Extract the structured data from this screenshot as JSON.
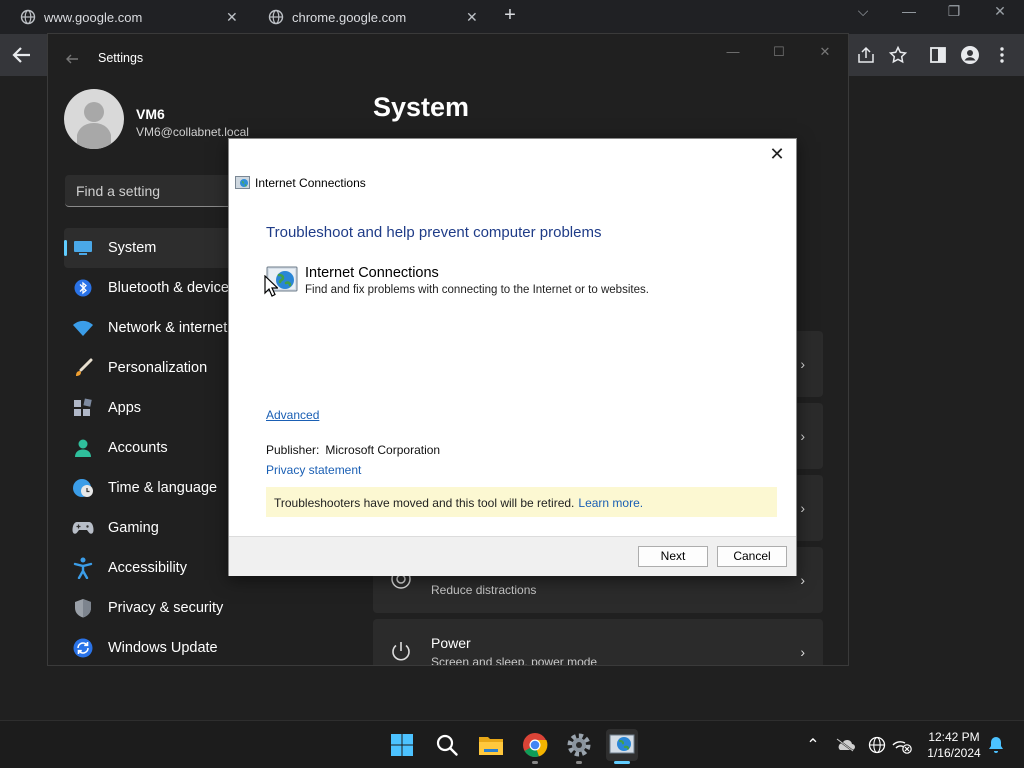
{
  "browser": {
    "tabs": [
      {
        "label": "www.google.com"
      },
      {
        "label": "chrome.google.com"
      }
    ],
    "new_tab": "+",
    "tab_close": "✕",
    "window_controls": {
      "dropdown": "⌵",
      "minimize": "—",
      "restore": "❐",
      "close": "✕"
    }
  },
  "settings": {
    "window_title": "Settings",
    "window_controls": {
      "minimize": "—",
      "maximize": "☐",
      "close": "✕"
    },
    "user": {
      "name": "VM6",
      "email": "VM6@collabnet.local"
    },
    "search_placeholder": "Find a setting",
    "nav": [
      {
        "label": "System",
        "icon": "monitor-icon"
      },
      {
        "label": "Bluetooth & devices",
        "icon": "bluetooth-icon"
      },
      {
        "label": "Network & internet",
        "icon": "wifi-icon"
      },
      {
        "label": "Personalization",
        "icon": "brush-icon"
      },
      {
        "label": "Apps",
        "icon": "apps-icon"
      },
      {
        "label": "Accounts",
        "icon": "person-icon"
      },
      {
        "label": "Time & language",
        "icon": "globe-clock-icon"
      },
      {
        "label": "Gaming",
        "icon": "gamepad-icon"
      },
      {
        "label": "Accessibility",
        "icon": "accessibility-icon"
      },
      {
        "label": "Privacy & security",
        "icon": "shield-icon"
      },
      {
        "label": "Windows Update",
        "icon": "update-icon"
      }
    ],
    "page_title": "System",
    "cards": {
      "focus_subtitle": "Reduce distractions",
      "power_title": "Power",
      "power_subtitle": "Screen and sleep, power mode",
      "chevron": "›"
    }
  },
  "dialog": {
    "title": "Internet Connections",
    "close": "✕",
    "heading": "Troubleshoot and help prevent computer problems",
    "item_title": "Internet Connections",
    "item_description": "Find and fix problems with connecting to the Internet or to websites.",
    "advanced_link": "Advanced",
    "publisher_label": "Publisher:",
    "publisher_value": "Microsoft Corporation",
    "privacy_link": "Privacy statement",
    "banner_text": "Troubleshooters have moved and this tool will be retired.",
    "banner_link": "Learn more.",
    "next_button": "Next",
    "cancel_button": "Cancel"
  },
  "taskbar": {
    "apps": [
      "start-icon",
      "search-icon",
      "file-explorer-icon",
      "chrome-icon",
      "settings-gear-icon",
      "troubleshooter-icon"
    ],
    "tray": [
      "chevron-up-icon",
      "onedrive-icon",
      "language-icon",
      "network-disconnected-icon",
      "notification-bell-icon"
    ],
    "tray_chevron": "⌃",
    "time": "12:42 PM",
    "date": "1/16/2024"
  },
  "colors": {
    "accent": "#60cdff",
    "link": "#1a5fb4",
    "heading_blue": "#1f3c88",
    "banner_bg": "#fcf8d2"
  }
}
